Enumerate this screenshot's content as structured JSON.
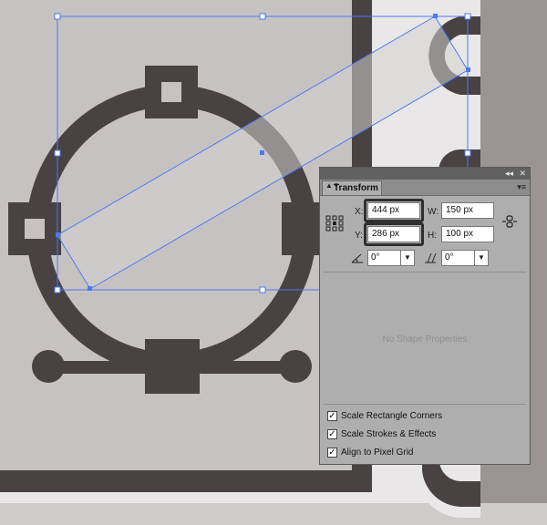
{
  "panel": {
    "collapse_glyph": "◂◂",
    "close_glyph": "✕",
    "tab_label": "Transform",
    "tab_arrows": "▲▼",
    "menu_glyph": "▾≡",
    "x_label": "X:",
    "x_value": "444 px",
    "y_label": "Y:",
    "y_value": "286 px",
    "w_label": "W:",
    "w_value": "150 px",
    "h_label": "H:",
    "h_value": "100 px",
    "rotate_value": "0°",
    "shear_value": "0°",
    "dropdown_glyph": "▼",
    "no_shape_text": "No Shape Properties",
    "checkboxes": [
      {
        "label": "Scale Rectangle Corners",
        "checked": true,
        "mark": "✓"
      },
      {
        "label": "Scale Strokes & Effects",
        "checked": true,
        "mark": "✓"
      },
      {
        "label": "Align to Pixel Grid",
        "checked": true,
        "mark": "✓"
      }
    ]
  },
  "colors": {
    "artboard": "#c7c2c2",
    "dark_shape": "#484242",
    "light_strip": "#e8e6e6",
    "side_panel": "#9b9494",
    "selection": "#4a7af2"
  }
}
